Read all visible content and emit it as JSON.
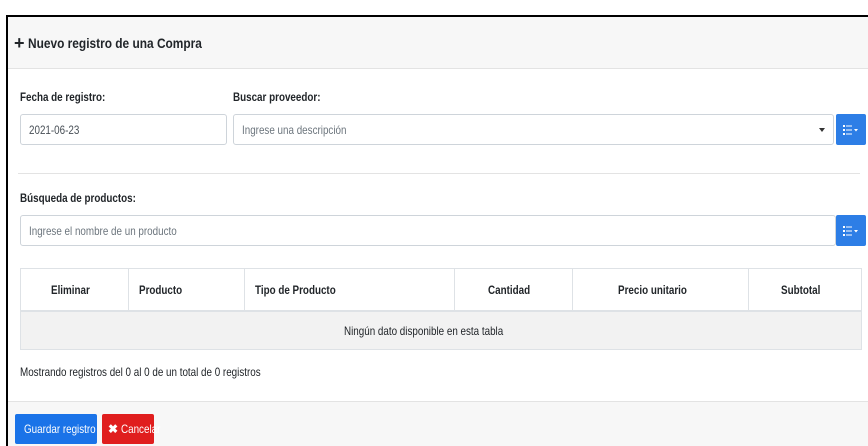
{
  "header": {
    "plus_icon": "plus-icon",
    "title": "Nuevo registro de una Compra"
  },
  "form": {
    "fecha_label": "Fecha de registro:",
    "fecha_value": "2021-06-23",
    "proveedor_label": "Buscar proveedor:",
    "proveedor_placeholder": "Ingrese una descripción",
    "productos_label": "Búsqueda de productos:",
    "productos_placeholder": "Ingrese el nombre de un producto"
  },
  "table": {
    "columns": [
      "Eliminar",
      "Producto",
      "Tipo de Producto",
      "Cantidad",
      "Precio unitario",
      "Subtotal"
    ],
    "empty_message": "Ningún dato disponible en esta tabla"
  },
  "info": "Mostrando registros del 0 al 0 de un total de 0 registros",
  "footer": {
    "save_label": "Guardar registro",
    "cancel_label": "Cancelar"
  },
  "colors": {
    "primary": "#1a73e8",
    "danger": "#e01e1e",
    "header_bg": "#f7f7f7"
  }
}
